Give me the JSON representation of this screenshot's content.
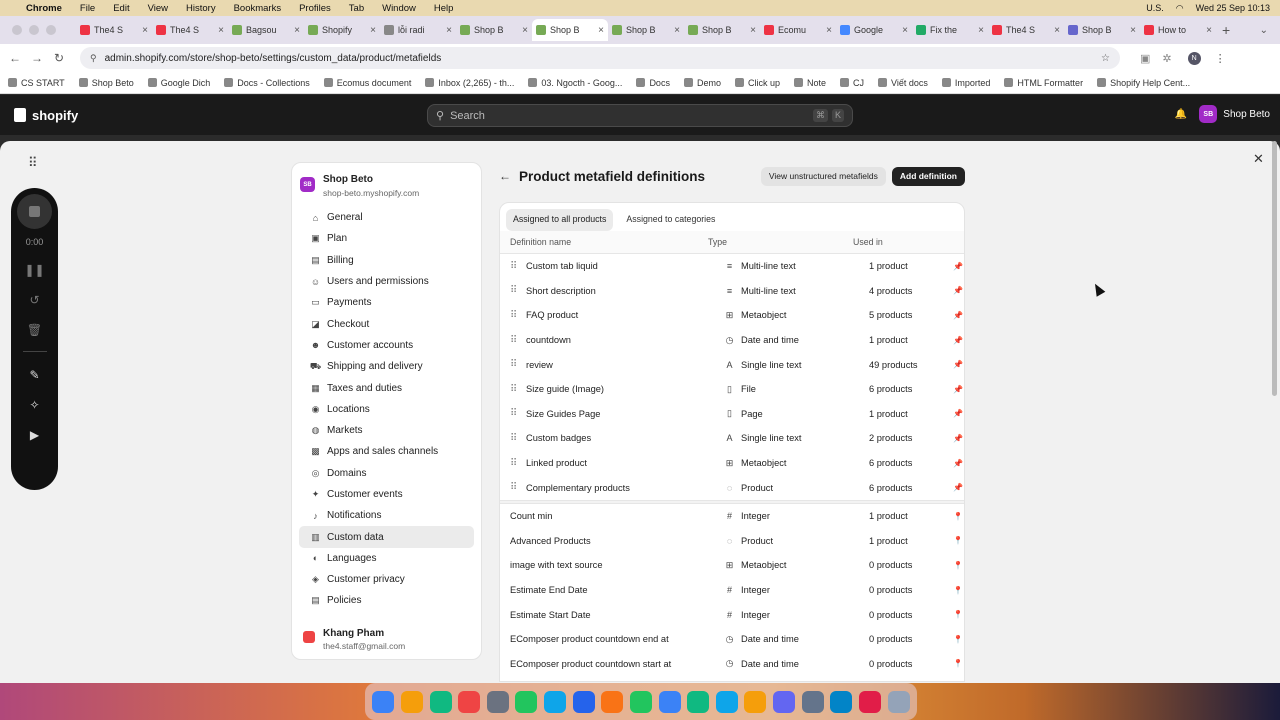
{
  "menubar": {
    "apple": "",
    "app": "Chrome",
    "items": [
      "File",
      "Edit",
      "View",
      "History",
      "Bookmarks",
      "Profiles",
      "Tab",
      "Window",
      "Help"
    ],
    "input_source": "U.S.",
    "datetime": "Wed 25 Sep  10:13"
  },
  "tabs": [
    {
      "label": "The4 S",
      "color": "#e34"
    },
    {
      "label": "The4 S",
      "color": "#e34"
    },
    {
      "label": "Bagsou",
      "color": "#7a5"
    },
    {
      "label": "Shopify",
      "color": "#7a5"
    },
    {
      "label": "lỗi radi",
      "color": "#888"
    },
    {
      "label": "Shop B",
      "color": "#7a5"
    },
    {
      "label": "Shop B",
      "color": "#7a5",
      "active": true
    },
    {
      "label": "Shop B",
      "color": "#7a5"
    },
    {
      "label": "Shop B",
      "color": "#7a5"
    },
    {
      "label": "Ecomu",
      "color": "#e34"
    },
    {
      "label": "Google",
      "color": "#48f"
    },
    {
      "label": "Fix the",
      "color": "#2a6"
    },
    {
      "label": "The4 S",
      "color": "#e34"
    },
    {
      "label": "Shop B",
      "color": "#66c"
    },
    {
      "label": "How to",
      "color": "#e34"
    }
  ],
  "address": {
    "url": "admin.shopify.com/store/shop-beto/settings/custom_data/product/metafields"
  },
  "bookmarks": [
    "CS START",
    "Shop Beto",
    "Google Dich",
    "Docs - Collections",
    "Ecomus document",
    "Inbox (2,265) - th...",
    "03. Ngocth - Goog...",
    "Docs",
    "Demo",
    "Click up",
    "Note",
    "CJ",
    "Viết docs",
    "Imported",
    "HTML Formatter",
    "Shopify Help Cent..."
  ],
  "header": {
    "logo": "shopify",
    "search_placeholder": "Search",
    "kbd1": "⌘",
    "kbd2": "K",
    "avatar": "SB",
    "store": "Shop Beto"
  },
  "recorder": {
    "time": "0:00"
  },
  "settings": {
    "shop_name": "Shop Beto",
    "shop_domain": "shop-beto.myshopify.com",
    "avatar": "SB",
    "items": [
      {
        "label": "General",
        "icon": "⌂"
      },
      {
        "label": "Plan",
        "icon": "▣"
      },
      {
        "label": "Billing",
        "icon": "▤"
      },
      {
        "label": "Users and permissions",
        "icon": "☺"
      },
      {
        "label": "Payments",
        "icon": "▭"
      },
      {
        "label": "Checkout",
        "icon": "◪"
      },
      {
        "label": "Customer accounts",
        "icon": "☻"
      },
      {
        "label": "Shipping and delivery",
        "icon": "⛟"
      },
      {
        "label": "Taxes and duties",
        "icon": "▦"
      },
      {
        "label": "Locations",
        "icon": "◉"
      },
      {
        "label": "Markets",
        "icon": "◍"
      },
      {
        "label": "Apps and sales channels",
        "icon": "▩"
      },
      {
        "label": "Domains",
        "icon": "◎"
      },
      {
        "label": "Customer events",
        "icon": "✦"
      },
      {
        "label": "Notifications",
        "icon": "♪"
      },
      {
        "label": "Custom data",
        "icon": "▥",
        "selected": true
      },
      {
        "label": "Languages",
        "icon": "◐"
      },
      {
        "label": "Customer privacy",
        "icon": "◈"
      },
      {
        "label": "Policies",
        "icon": "▤"
      }
    ],
    "user_name": "Khang Pham",
    "user_email": "the4.staff@gmail.com"
  },
  "page": {
    "title": "Product metafield definitions",
    "btn_unstructured": "View unstructured metafields",
    "btn_add": "Add definition",
    "tab_all": "Assigned to all products",
    "tab_cat": "Assigned to categories",
    "col_name": "Definition name",
    "col_type": "Type",
    "col_used": "Used in"
  },
  "pinned": [
    {
      "name": "Custom tab liquid",
      "type": "Multi-line text",
      "icon": "≡",
      "used": "1 product"
    },
    {
      "name": "Short description",
      "type": "Multi-line text",
      "icon": "≡",
      "used": "4 products"
    },
    {
      "name": "FAQ product",
      "type": "Metaobject",
      "icon": "⊞",
      "used": "5 products"
    },
    {
      "name": "countdown",
      "type": "Date and time",
      "icon": "◷",
      "used": "1 product"
    },
    {
      "name": "review",
      "type": "Single line text",
      "icon": "A",
      "used": "49 products"
    },
    {
      "name": "Size guide (Image)",
      "type": "File",
      "icon": "▯",
      "used": "6 products"
    },
    {
      "name": "Size Guides Page",
      "type": "Page",
      "icon": "▯",
      "used": "1 product"
    },
    {
      "name": "Custom badges",
      "type": "Single line text",
      "icon": "A",
      "used": "2 products"
    },
    {
      "name": "Linked product",
      "type": "Metaobject",
      "icon": "⊞",
      "used": "6 products"
    },
    {
      "name": "Complementary products",
      "type": "Product",
      "icon": "◌",
      "used": "6 products"
    }
  ],
  "unpinned": [
    {
      "name": "Count min",
      "type": "Integer",
      "icon": "#",
      "used": "1 product"
    },
    {
      "name": "Advanced Products",
      "type": "Product",
      "icon": "◌",
      "used": "1 product"
    },
    {
      "name": "image with text source",
      "type": "Metaobject",
      "icon": "⊞",
      "used": "0 products"
    },
    {
      "name": "Estimate End Date",
      "type": "Integer",
      "icon": "#",
      "used": "0 products"
    },
    {
      "name": "Estimate Start Date",
      "type": "Integer",
      "icon": "#",
      "used": "0 products"
    },
    {
      "name": "EComposer product countdown end at",
      "type": "Date and time",
      "icon": "◷",
      "used": "0 products"
    },
    {
      "name": "EComposer product countdown start at",
      "type": "Date and time",
      "icon": "◷",
      "used": "0 products"
    }
  ]
}
